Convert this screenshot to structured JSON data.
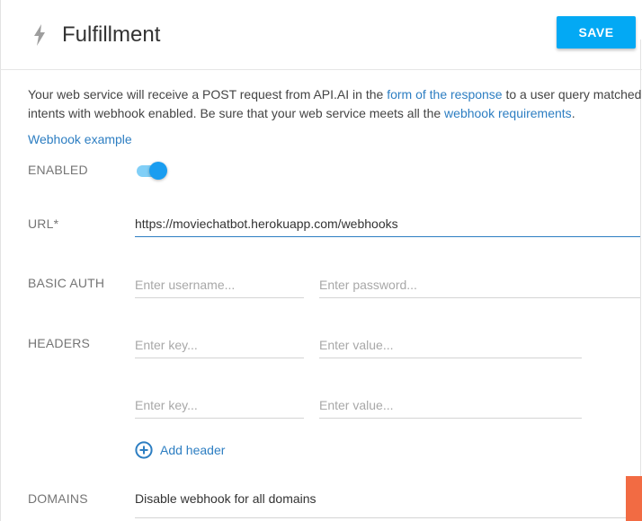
{
  "header": {
    "title": "Fulfillment",
    "save_label": "SAVE",
    "icon": "bolt-icon"
  },
  "description": {
    "line1_before_link": "Your web service will receive a POST request from API.AI in the ",
    "link1": "form of the response",
    "line1_after_link": " to a user query matched by",
    "line2_before_link": "intents with webhook enabled. Be sure that your web service meets all the ",
    "link2": "webhook requirements",
    "line2_after_link": ".",
    "example_link": "Webhook example"
  },
  "enabled": {
    "label": "ENABLED",
    "value": true
  },
  "url": {
    "label": "URL*",
    "value": "https://moviechatbot.herokuapp.com/webhooks"
  },
  "basic_auth": {
    "label": "BASIC AUTH",
    "username_placeholder": "Enter username...",
    "password_placeholder": "Enter password..."
  },
  "headers": {
    "label": "HEADERS",
    "key_placeholder": "Enter key...",
    "value_placeholder": "Enter value...",
    "add_label": "Add header"
  },
  "domains": {
    "label": "DOMAINS",
    "value": "Disable webhook for all domains"
  },
  "colors": {
    "accent": "#03a9f4",
    "link": "#2d7ec2",
    "toggle_thumb": "#1a9df0",
    "side_tab": "#f26b43"
  }
}
